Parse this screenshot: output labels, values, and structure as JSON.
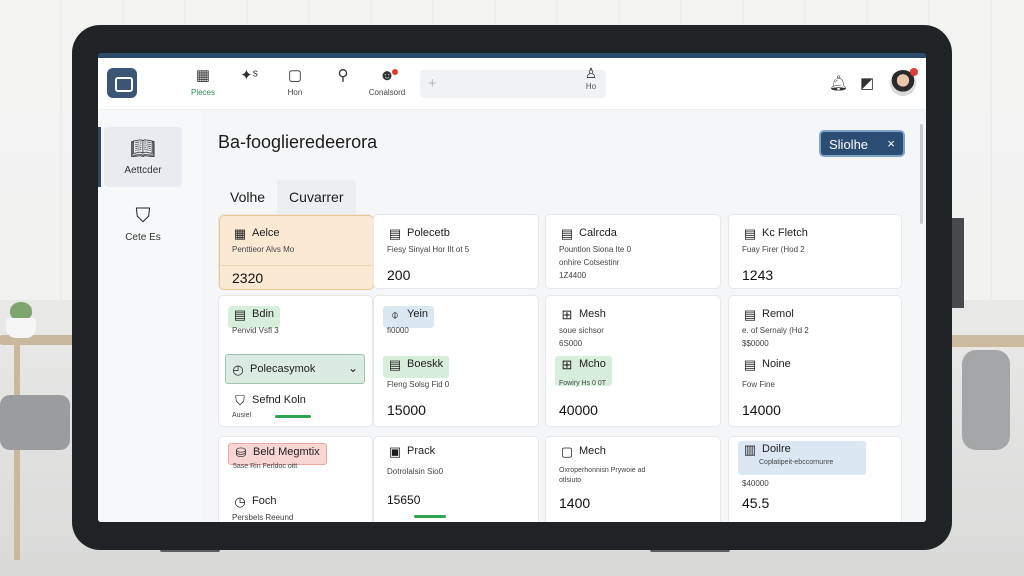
{
  "colors": {
    "accent": "#2d4a6b",
    "pill_bg": "#2c4d73",
    "success": "#2ea44f",
    "alert": "#e03b3b"
  },
  "nav": {
    "items": [
      {
        "label": "Pleces",
        "icon": "grid-icon"
      },
      {
        "label": "",
        "icon": "sparkle-icon"
      },
      {
        "label": "Hon",
        "icon": "chat-icon"
      },
      {
        "label": "",
        "icon": "search-icon"
      },
      {
        "label": "Conalsord",
        "icon": "user-alert-icon"
      }
    ],
    "search_placeholder": "",
    "search_user_label": "Ho"
  },
  "sidebar": {
    "items": [
      {
        "label": "Aettcder",
        "icon": "book-icon"
      },
      {
        "label": "Cete Es",
        "icon": "shield-icon"
      }
    ]
  },
  "main": {
    "title": "Ba-fooglieredeerora",
    "pill": {
      "label": "Sliolhe",
      "close": "×"
    },
    "tabs": [
      "Volhe",
      "Cuvarrer"
    ]
  },
  "cards": [
    {
      "title": "Aelce",
      "icon": "calendar-icon",
      "sub": "Penttieor Alvs Mo",
      "value": "2320"
    },
    {
      "title": "Polecetb",
      "icon": "document-icon",
      "sub": "Fiesy Sinyal Hor Ilt ot 5",
      "value": "200"
    },
    {
      "title": "Calrcda",
      "icon": "document-icon",
      "sub": "Pountlon Siona Ite 0",
      "sub2": "onhire Cotsestinr",
      "value": "1Z4400"
    },
    {
      "title": "Kc Fletch",
      "icon": "document-icon",
      "sub": "Fuay Firer (Hod 2",
      "value": "1243"
    },
    {
      "title": "Bdin",
      "icon": "document-icon",
      "sub": "Penvid Vsfl 3",
      "value": ""
    },
    {
      "title": "Yein",
      "icon": "clip-icon",
      "sub": "fi0000",
      "value": ""
    },
    {
      "title": "Mesh",
      "icon": "grid-icon",
      "sub": "soue sichsor",
      "sub2": "6S000",
      "value": ""
    },
    {
      "title": "Remol",
      "icon": "document-icon",
      "sub": "e. of Sernaly (Hd 2",
      "sub2": "$$0000",
      "value": ""
    },
    {
      "title": "Polecasymok",
      "icon": "compass-icon",
      "sub": "",
      "value": ""
    },
    {
      "title": "Boeskk",
      "icon": "document-icon",
      "sub": "Fleng Solsg Fid 0",
      "value": "15000"
    },
    {
      "title": "Mcho",
      "icon": "plus-box-icon",
      "sub": "Fowiry Hs 0 0T",
      "value": "40000"
    },
    {
      "title": "Noine",
      "icon": "document-icon",
      "sub": "Fow Fine",
      "value": "14000"
    },
    {
      "title": "Sefnd Koln",
      "icon": "shield-icon",
      "sub": "Ausiel",
      "value": ""
    },
    {
      "title": "Beld Megmtix",
      "icon": "database-icon",
      "sub": "5ase Rin Ferldoc oitt",
      "value": ""
    },
    {
      "title": "Prack",
      "icon": "dollar-icon",
      "sub": "Dotrolalsin Sio0",
      "sub2": "15650",
      "value": ""
    },
    {
      "title": "Mech",
      "icon": "briefcase-icon",
      "sub": "Oxroperhonnisn Prywoie ad",
      "sub2": "otlsiuto",
      "value": "1400"
    },
    {
      "title": "Doilre",
      "icon": "chart-icon",
      "sub": "Coplatipeit-ebccornunre",
      "sub2": "$40000",
      "value": "45.5"
    },
    {
      "title": "Foch",
      "icon": "clock-icon",
      "sub": "Persbels Reeund",
      "value": ""
    }
  ]
}
